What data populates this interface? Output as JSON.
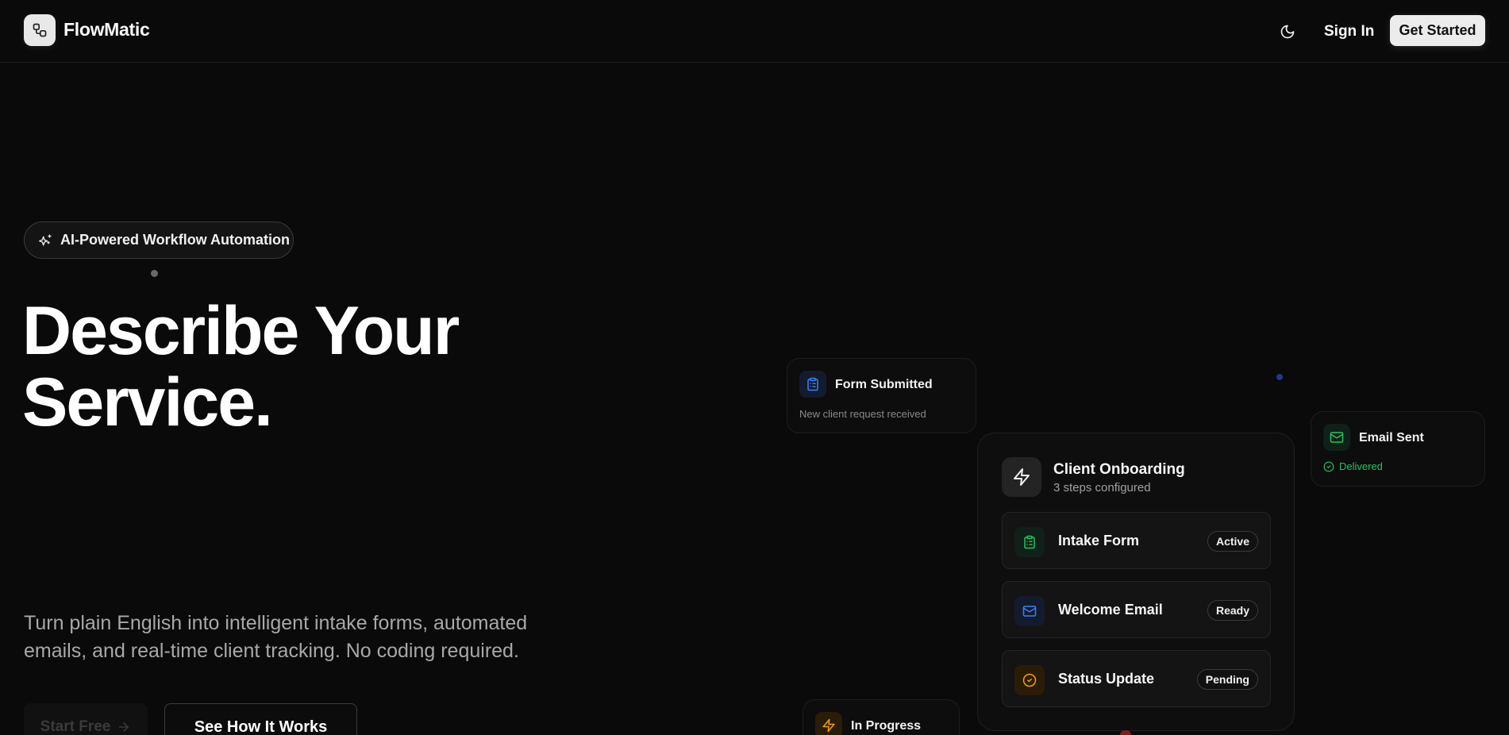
{
  "header": {
    "brand": "FlowMatic",
    "sign_in": "Sign In",
    "get_started": "Get Started"
  },
  "hero": {
    "badge": "AI-Powered Workflow Automation",
    "title_line1": "Describe Your",
    "title_line2": "Service.",
    "subtitle": "Turn plain English into intelligent intake forms, automated emails, and real-time client tracking. No coding required.",
    "primary_cta": "Start Free",
    "secondary_cta": "See How It Works"
  },
  "floating": {
    "form_submitted": {
      "title": "Form Submitted",
      "subtitle": "New client request received"
    },
    "email_sent": {
      "title": "Email Sent",
      "status": "Delivered"
    },
    "in_progress": {
      "title": "In Progress"
    }
  },
  "workflow": {
    "title": "Client Onboarding",
    "subtitle": "3 steps configured",
    "steps": [
      {
        "label": "Intake Form",
        "status": "Active"
      },
      {
        "label": "Welcome Email",
        "status": "Ready"
      },
      {
        "label": "Status Update",
        "status": "Pending"
      }
    ]
  },
  "colors": {
    "background": "#0a0a0a",
    "green": "#22c55e",
    "blue": "#3b82f6",
    "orange": "#f59e0b"
  },
  "icons": {
    "logo": "workflow-icon",
    "theme": "moon-icon",
    "badge": "sparkles-icon",
    "form": "clipboard-icon",
    "email": "mail-icon",
    "status": "check-circle-icon",
    "zap": "zap-icon",
    "arrow": "arrow-right-icon"
  }
}
